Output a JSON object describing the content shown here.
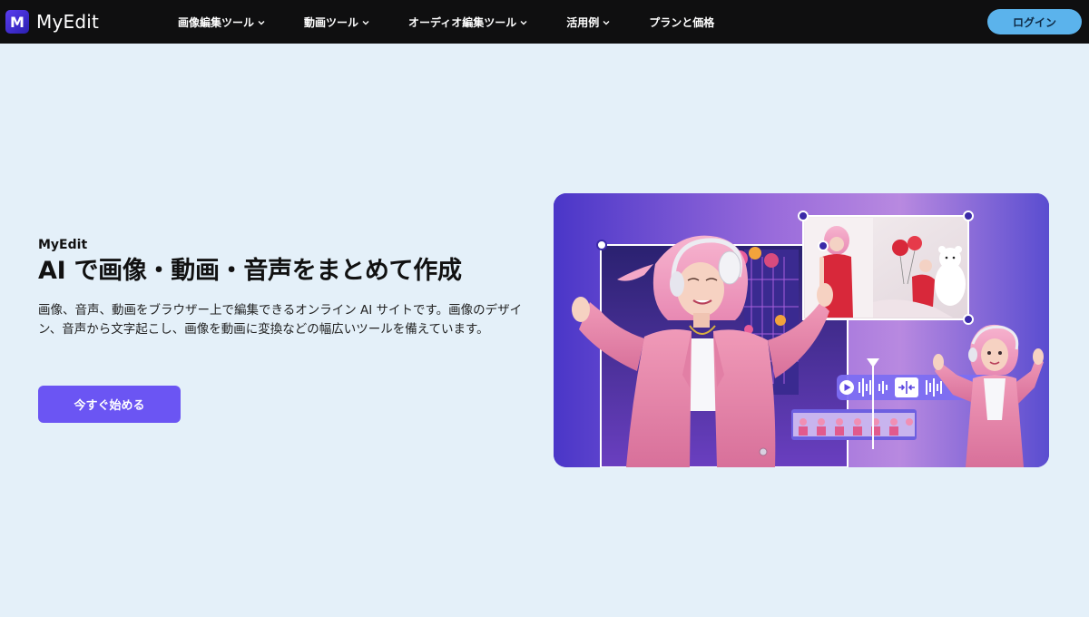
{
  "app": {
    "brand": "MyEdit",
    "logo_glyph": "M"
  },
  "nav": {
    "items": [
      {
        "label": "画像編集ツール",
        "has_dropdown": true
      },
      {
        "label": "動画ツール",
        "has_dropdown": true
      },
      {
        "label": "オーディオ編集ツール",
        "has_dropdown": true
      },
      {
        "label": "活用例",
        "has_dropdown": true
      },
      {
        "label": "プランと価格",
        "has_dropdown": false
      }
    ],
    "login_label": "ログイン"
  },
  "hero": {
    "eyebrow": "MyEdit",
    "headline": "AI で画像・動画・音声をまとめて作成",
    "description": "画像、音声、動画をブラウザー上で編集できるオンライン AI サイトです。画像のデザイン、音声から文字起こし、画像を動画に変換などの幅広いツールを備えています。",
    "cta_label": "今すぐ始める"
  },
  "colors": {
    "header_bg": "#0f0f10",
    "page_bg": "#e4f0f9",
    "login_bg": "#5bb3ec",
    "cta_bg": "#6b55f3",
    "hero_card_start": "#4b35c9",
    "hero_card_mid": "#a476d8"
  },
  "icons": {
    "logo": "myedit-logo-icon",
    "nav_dropdown": "chevron-down-icon",
    "play": "play-icon",
    "split": "split-icon"
  }
}
